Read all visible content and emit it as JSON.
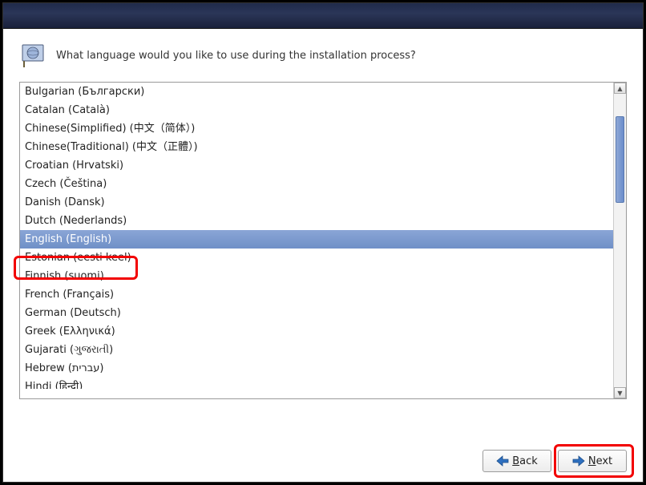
{
  "header": {
    "prompt": "What language would you like to use during the installation process?"
  },
  "languages": {
    "items": [
      "Bulgarian (Български)",
      "Catalan (Català)",
      "Chinese(Simplified) (中文（简体）)",
      "Chinese(Traditional) (中文（正體）)",
      "Croatian (Hrvatski)",
      "Czech (Čeština)",
      "Danish (Dansk)",
      "Dutch (Nederlands)",
      "English (English)",
      "Estonian (eesti keel)",
      "Finnish (suomi)",
      "French (Français)",
      "German (Deutsch)",
      "Greek (Ελληνικά)",
      "Gujarati (ગુજરાતી)",
      "Hebrew (עברית)",
      "Hindi (हिन्दी)"
    ],
    "selected_index": 8
  },
  "buttons": {
    "back": "Back",
    "next": "Next"
  }
}
